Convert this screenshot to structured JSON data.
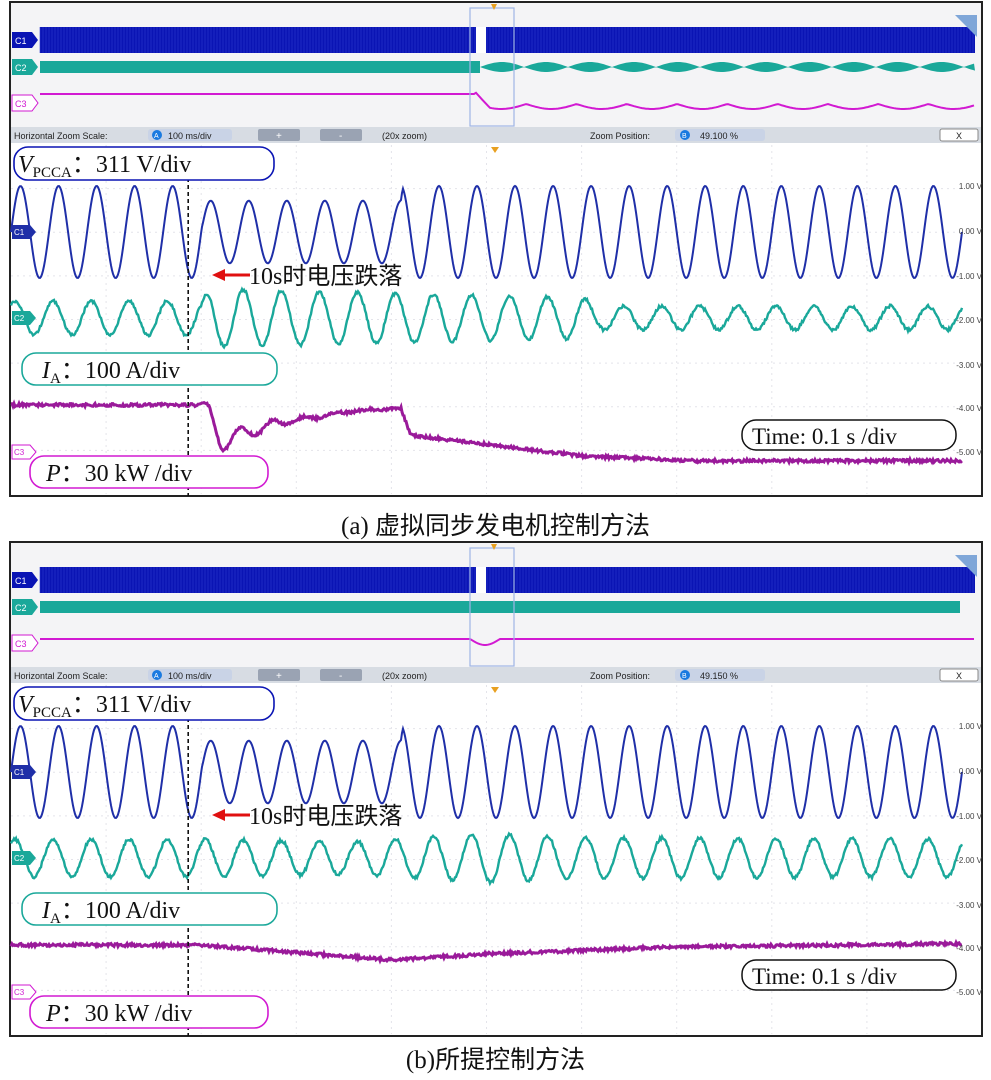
{
  "figure": {
    "panels": [
      {
        "caption": "(a) 虚拟同步发电机控制方法",
        "zoom_bar": {
          "scale_label": "Horizontal Zoom Scale:",
          "scale_badge": "A",
          "scale_value": "100 ms/div",
          "plus_label": "+",
          "minus_label": "-",
          "zoom_text": "(20x zoom)",
          "position_label": "Zoom Position:",
          "position_badge": "B",
          "position_value": "49.100 %",
          "close_label": "X"
        },
        "overview_channels": [
          "C1",
          "C2",
          "C3"
        ],
        "channel_markers": [
          "C1",
          "C2",
          "C3"
        ],
        "labels": {
          "v_main": "V",
          "v_sub": "PCCA",
          "v_scale": "：311 V/div",
          "i_main": "I",
          "i_sub": "A",
          "i_scale": "：100 A/div",
          "p_main": "P",
          "p_scale": "：30 kW /div",
          "time": "Time: 0.1 s /div",
          "event": "10s时电压跌落"
        },
        "right_scale": [
          "1.00 V",
          "0.00 V",
          "-1.00 V",
          "-2.00 V",
          "-3.00 V",
          "-4.00 V",
          "-5.00 V"
        ]
      },
      {
        "caption": "(b)所提控制方法",
        "zoom_bar": {
          "scale_label": "Horizontal Zoom Scale:",
          "scale_badge": "A",
          "scale_value": "100 ms/div",
          "plus_label": "+",
          "minus_label": "-",
          "zoom_text": "(20x zoom)",
          "position_label": "Zoom Position:",
          "position_badge": "B",
          "position_value": "49.150 %",
          "close_label": "X"
        },
        "overview_channels": [
          "C1",
          "C2",
          "C3"
        ],
        "channel_markers": [
          "C1",
          "C2",
          "C3"
        ],
        "labels": {
          "v_main": "V",
          "v_sub": "PCCA",
          "v_scale": "：311 V/div",
          "i_main": "I",
          "i_sub": "A",
          "i_scale": "：100 A/div",
          "p_main": "P",
          "p_scale": "：30 kW /div",
          "time": "Time: 0.1 s /div",
          "event": "10s时电压跌落"
        },
        "right_scale": [
          "1.00 V",
          "0.00 V",
          "-1.00 V",
          "-2.00 V",
          "-3.00 V",
          "-4.00 V",
          "-5.00 V"
        ]
      }
    ]
  },
  "colors": {
    "voltage": "#1f2fa8",
    "overview_voltage": "#0a14b4",
    "current": "#1aa89a",
    "power": "#9a1a9a",
    "overview_power": "#d21ad2",
    "arrow": "#e01010",
    "zoom_bar_bg": "#d7dce3",
    "badge": "#1a7ae0"
  },
  "chart_data": [
    {
      "type": "line",
      "x_unit": "s",
      "x_range": [
        9.9,
        10.4
      ],
      "grid": true,
      "event_time": 10.0,
      "series": [
        {
          "name": "V_PCCA",
          "scale": "311 V/div",
          "points": [
            [
              9.9,
              1.0
            ],
            [
              10.0,
              1.0
            ],
            [
              10.001,
              0.68
            ],
            [
              10.105,
              0.68
            ],
            [
              10.106,
              1.0
            ],
            [
              10.4,
              1.0
            ]
          ]
        },
        {
          "name": "I_A",
          "scale": "100 A/div",
          "points": [
            [
              9.9,
              0.5
            ],
            [
              10.0,
              0.5
            ],
            [
              10.005,
              0.85
            ],
            [
              10.2,
              0.6
            ],
            [
              10.21,
              0.35
            ],
            [
              10.4,
              0.35
            ]
          ]
        },
        {
          "name": "P",
          "scale": "30 kW /div",
          "points": [
            [
              9.9,
              0.95
            ],
            [
              10.0,
              0.95
            ],
            [
              10.01,
              0.35
            ],
            [
              10.04,
              0.65
            ],
            [
              10.08,
              0.85
            ],
            [
              10.105,
              0.9
            ],
            [
              10.11,
              0.45
            ],
            [
              10.2,
              0.1
            ],
            [
              10.26,
              0.02
            ],
            [
              10.4,
              0.02
            ]
          ]
        }
      ]
    },
    {
      "type": "line",
      "x_unit": "s",
      "x_range": [
        9.9,
        10.4
      ],
      "grid": true,
      "event_time": 10.0,
      "series": [
        {
          "name": "V_PCCA",
          "scale": "311 V/div",
          "points": [
            [
              9.9,
              1.0
            ],
            [
              10.0,
              1.0
            ],
            [
              10.001,
              0.68
            ],
            [
              10.105,
              0.68
            ],
            [
              10.106,
              1.0
            ],
            [
              10.4,
              1.0
            ]
          ]
        },
        {
          "name": "I_A",
          "scale": "100 A/div",
          "points": [
            [
              9.9,
              0.55
            ],
            [
              10.0,
              0.55
            ],
            [
              10.08,
              0.48
            ],
            [
              10.15,
              0.72
            ],
            [
              10.2,
              0.6
            ],
            [
              10.4,
              0.55
            ]
          ]
        },
        {
          "name": "P",
          "scale": "30 kW /div",
          "points": [
            [
              9.9,
              0.95
            ],
            [
              10.0,
              0.95
            ],
            [
              10.1,
              0.7
            ],
            [
              10.15,
              0.8
            ],
            [
              10.25,
              0.92
            ],
            [
              10.4,
              0.97
            ]
          ]
        }
      ]
    }
  ]
}
